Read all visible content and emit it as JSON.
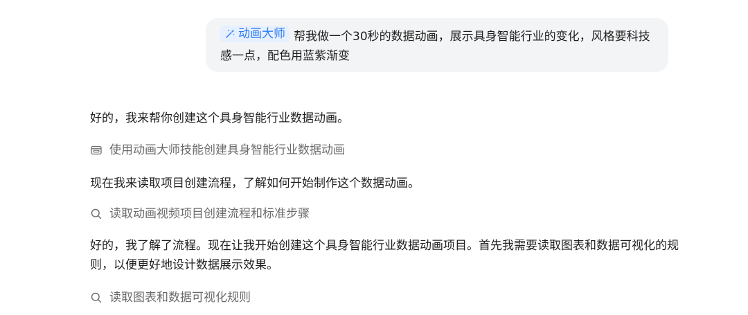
{
  "user_message": {
    "skill_tag": {
      "icon": "magic-wand-icon",
      "label": "动画大师"
    },
    "text": "帮我做一个30秒的数据动画，展示具身智能行业的变化，风格要科技感一点，配色用蓝紫渐变"
  },
  "assistant": {
    "reply_1": "好的，我来帮你创建这个具身智能行业数据动画。",
    "step_1": {
      "icon": "skill-icon",
      "text": "使用动画大师技能创建具身智能行业数据动画"
    },
    "reply_2": "现在我来读取项目创建流程，了解如何开始制作这个数据动画。",
    "step_2": {
      "icon": "search-icon",
      "text": "读取动画视频项目创建流程和标准步骤"
    },
    "reply_3": "好的，我了解了流程。现在让我开始创建这个具身智能行业数据动画项目。首先我需要读取图表和数据可视化的规则，以便更好地设计数据展示效果。",
    "step_3": {
      "icon": "search-icon",
      "text": "读取图表和数据可视化规则"
    }
  },
  "colors": {
    "bubble_bg": "#f3f4f6",
    "tag_bg": "#e6f0ff",
    "tag_text": "#2f7bf5",
    "step_text": "#6b6b6b"
  }
}
